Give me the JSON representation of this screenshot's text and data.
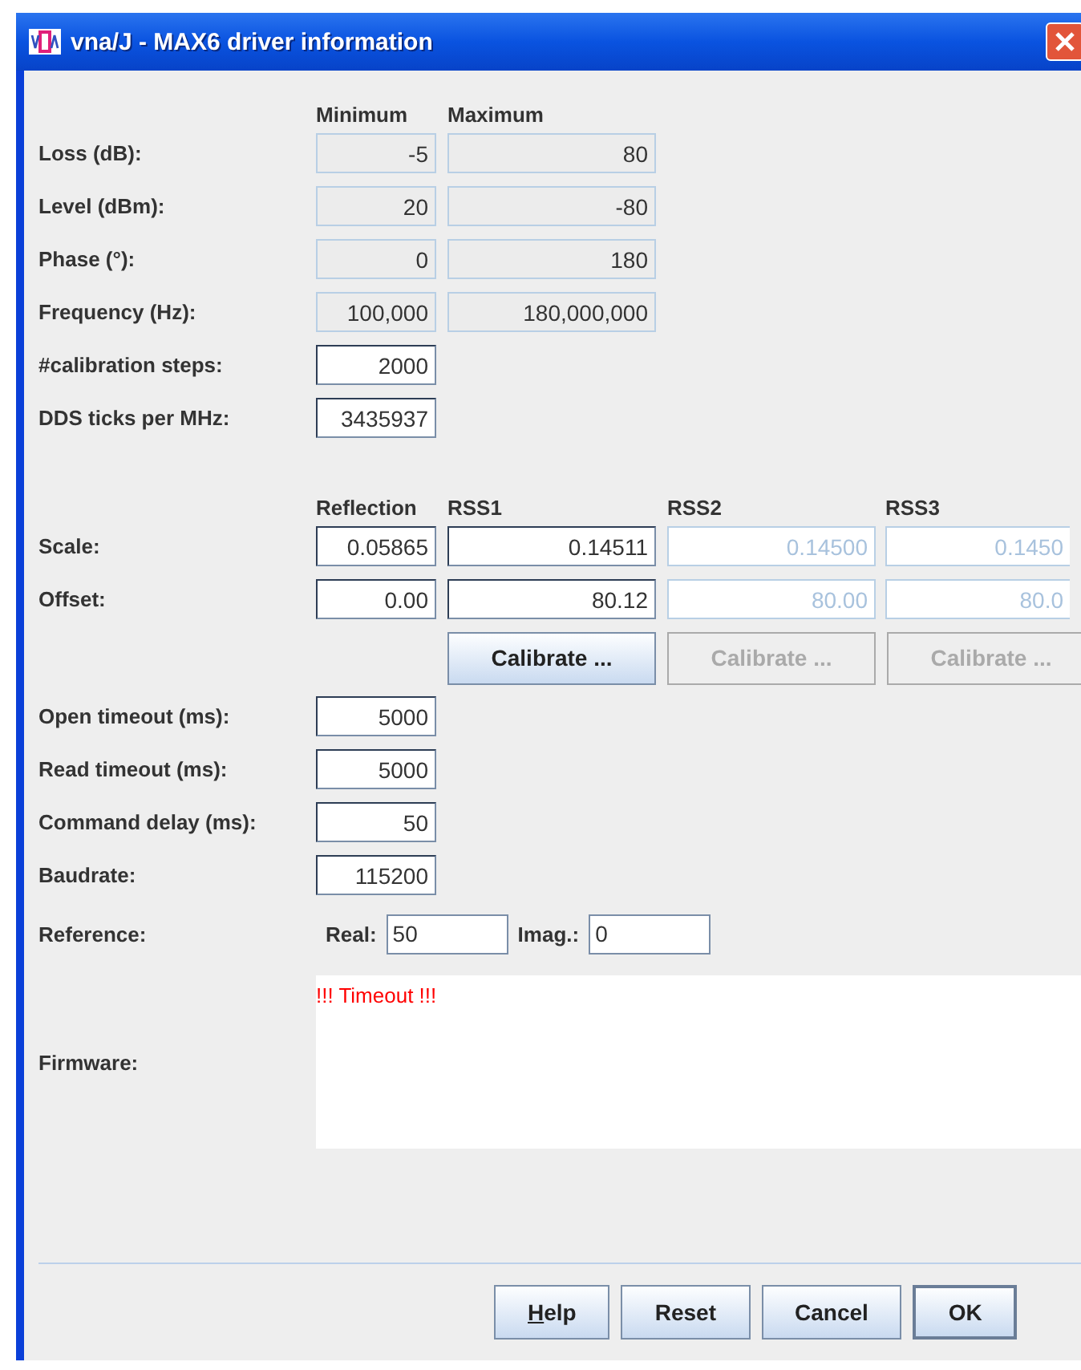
{
  "window": {
    "title": "vna/J - MAX6 driver information"
  },
  "limits": {
    "columns": [
      "Minimum",
      "Maximum"
    ],
    "rows": [
      {
        "label": "Loss (dB):",
        "values": [
          "-5",
          "80"
        ]
      },
      {
        "label": "Level (dBm):",
        "values": [
          "20",
          "-80"
        ]
      },
      {
        "label": "Phase (°):",
        "values": [
          "0",
          "180"
        ]
      },
      {
        "label": "Frequency (Hz):",
        "values": [
          "100,000",
          "180,000,000"
        ]
      }
    ]
  },
  "settings_top": [
    {
      "label": "#calibration steps:",
      "value": "2000"
    },
    {
      "label": "DDS ticks per MHz:",
      "value": "3435937"
    }
  ],
  "calibration": {
    "columns": [
      "Reflection",
      "RSS1",
      "RSS2",
      "RSS3"
    ],
    "rows": [
      {
        "label": "Scale:",
        "cells": [
          {
            "value": "0.05865",
            "disabled": false
          },
          {
            "value": "0.14511",
            "disabled": false
          },
          {
            "value": "0.14500",
            "disabled": true
          },
          {
            "value": "0.1450",
            "disabled": true
          }
        ]
      },
      {
        "label": "Offset:",
        "cells": [
          {
            "value": "0.00",
            "disabled": false
          },
          {
            "value": "80.12",
            "disabled": false
          },
          {
            "value": "80.00",
            "disabled": true
          },
          {
            "value": "80.0",
            "disabled": true
          }
        ]
      }
    ],
    "buttons": [
      {
        "label": "Calibrate ...",
        "disabled": false
      },
      {
        "label": "Calibrate ...",
        "disabled": true
      },
      {
        "label": "Calibrate ...",
        "disabled": true
      }
    ]
  },
  "settings_bottom": [
    {
      "label": "Open timeout (ms):",
      "value": "5000"
    },
    {
      "label": "Read timeout (ms):",
      "value": "5000"
    },
    {
      "label": "Command delay (ms):",
      "value": "50"
    },
    {
      "label": "Baudrate:",
      "value": "115200"
    }
  ],
  "reference": {
    "label": "Reference:",
    "real_label": "Real:",
    "real": "50",
    "imag_label": "Imag.:",
    "imag": "0"
  },
  "firmware": {
    "label": "Firmware:",
    "text": "!!! Timeout !!!"
  },
  "footer": [
    {
      "label": "Help",
      "underline_first": true,
      "default": false
    },
    {
      "label": "Reset",
      "underline_first": false,
      "default": false
    },
    {
      "label": "Cancel",
      "underline_first": false,
      "default": false
    },
    {
      "label": "OK",
      "underline_first": false,
      "default": true
    }
  ]
}
